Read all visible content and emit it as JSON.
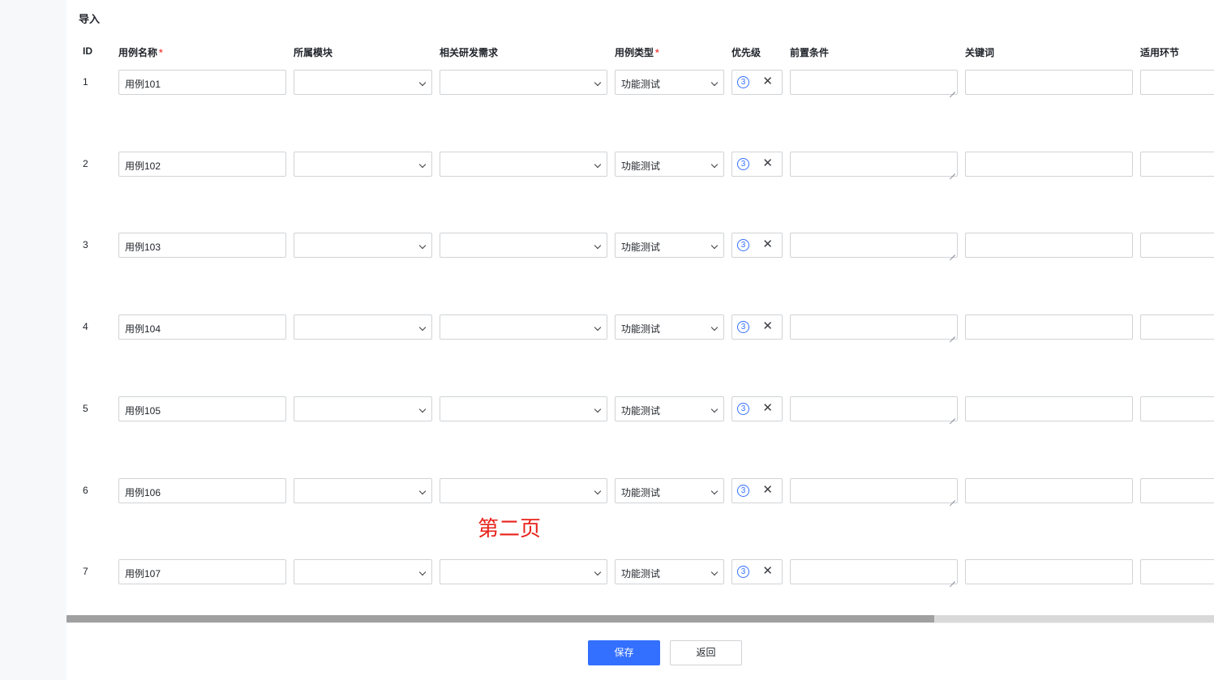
{
  "page": {
    "title": "导入",
    "annotation": "第二页",
    "save_label": "保存",
    "back_label": "返回"
  },
  "columns": {
    "id": "ID",
    "name": "用例名称",
    "module": "所属模块",
    "requirement": "相关研发需求",
    "type": "用例类型",
    "priority": "优先级",
    "precondition": "前置条件",
    "keyword": "关键词",
    "stage": "适用环节",
    "required_mark": "*"
  },
  "rows": [
    {
      "id": "1",
      "name": "用例101",
      "type": "功能测试",
      "priority": "3"
    },
    {
      "id": "2",
      "name": "用例102",
      "type": "功能测试",
      "priority": "3"
    },
    {
      "id": "3",
      "name": "用例103",
      "type": "功能测试",
      "priority": "3"
    },
    {
      "id": "4",
      "name": "用例104",
      "type": "功能测试",
      "priority": "3"
    },
    {
      "id": "5",
      "name": "用例105",
      "type": "功能测试",
      "priority": "3"
    },
    {
      "id": "6",
      "name": "用例106",
      "type": "功能测试",
      "priority": "3"
    },
    {
      "id": "7",
      "name": "用例107",
      "type": "功能测试",
      "priority": "3"
    }
  ],
  "icons": {
    "clear": "close-icon",
    "dropdown": "chevron-down-icon"
  },
  "colors": {
    "primary": "#3370ff",
    "required": "#f54a45",
    "annotation": "#e8221b"
  }
}
